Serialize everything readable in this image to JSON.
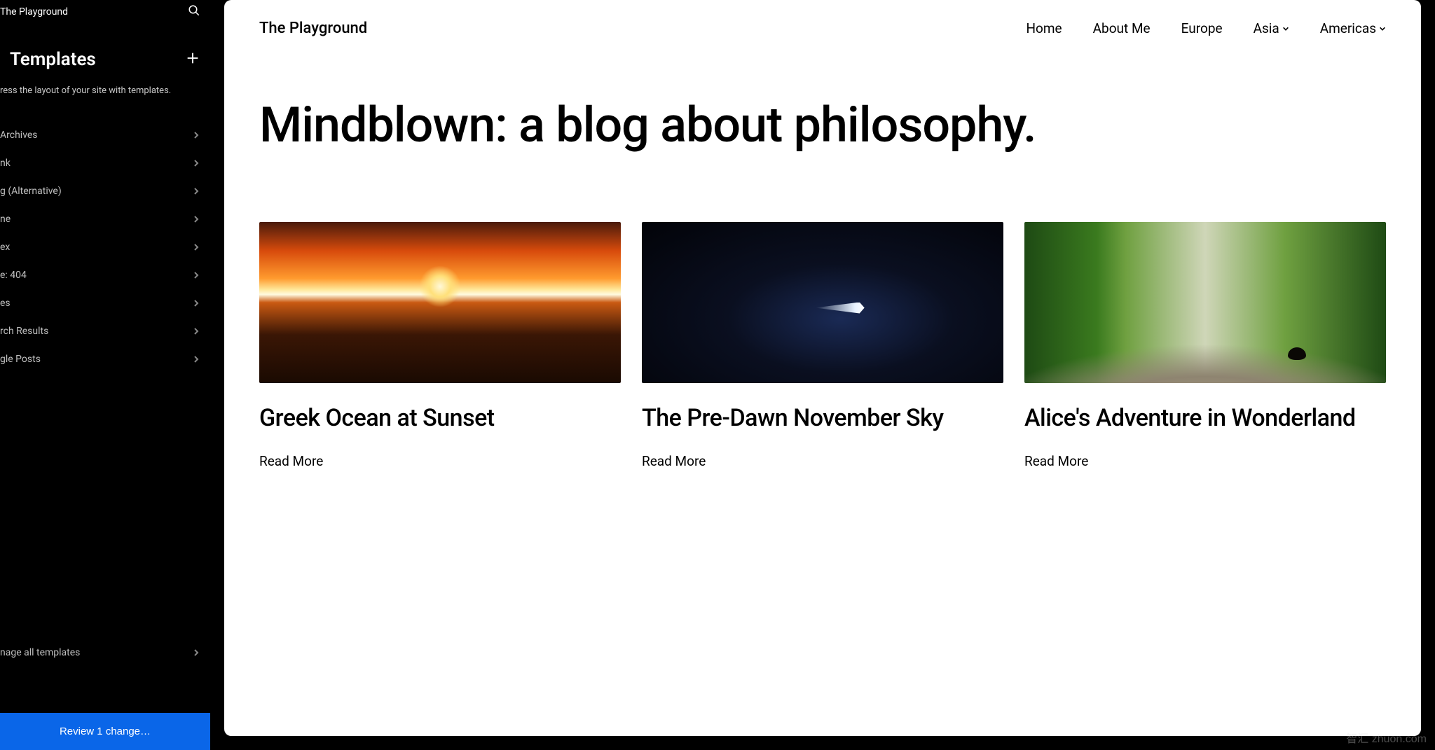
{
  "sidebar": {
    "site_title": "The Playground",
    "heading": "Templates",
    "description": "ress the layout of your site with templates.",
    "items": [
      {
        "label": "Archives"
      },
      {
        "label": "nk"
      },
      {
        "label": "g (Alternative)"
      },
      {
        "label": "ne"
      },
      {
        "label": "ex"
      },
      {
        "label": "e: 404"
      },
      {
        "label": "es"
      },
      {
        "label": "rch Results"
      },
      {
        "label": "gle Posts"
      }
    ],
    "manage_all": "nage all templates",
    "review_button": "Review 1 change…"
  },
  "preview": {
    "site_name": "The Playground",
    "nav": [
      {
        "label": "Home",
        "dropdown": false
      },
      {
        "label": "About Me",
        "dropdown": false
      },
      {
        "label": "Europe",
        "dropdown": false
      },
      {
        "label": "Asia",
        "dropdown": true
      },
      {
        "label": "Americas",
        "dropdown": true
      }
    ],
    "hero_title": "Mindblown: a blog about philosophy.",
    "posts": [
      {
        "title": "Greek Ocean at Sunset",
        "read_more": "Read More",
        "thumb": "sunset"
      },
      {
        "title": "The Pre-Dawn November Sky",
        "read_more": "Read More",
        "thumb": "night"
      },
      {
        "title": "Alice's Adventure in Wonderland",
        "read_more": "Read More",
        "thumb": "path"
      }
    ]
  },
  "watermark": "智汇 zhuon.com"
}
